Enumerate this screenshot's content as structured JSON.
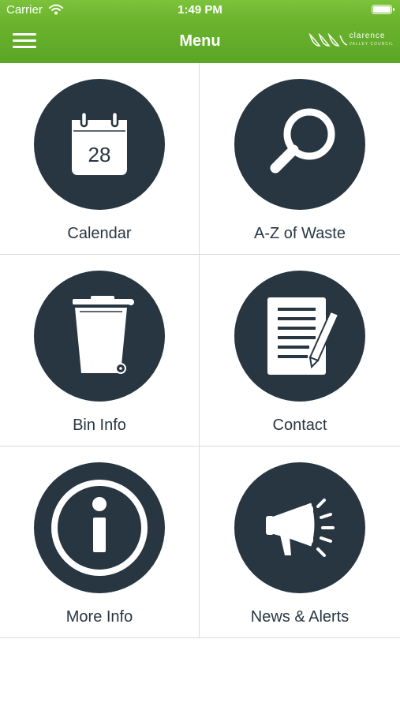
{
  "status_bar": {
    "carrier": "Carrier",
    "time": "1:49 PM"
  },
  "nav": {
    "title": "Menu",
    "logo_text": "clarence",
    "logo_subtext": "VALLEY COUNCIL"
  },
  "tiles": [
    {
      "label": "Calendar",
      "icon": "calendar-icon",
      "icon_text": "28"
    },
    {
      "label": "A-Z of Waste",
      "icon": "magnifier-icon"
    },
    {
      "label": "Bin Info",
      "icon": "wheelie-bin-icon"
    },
    {
      "label": "Contact",
      "icon": "document-pen-icon"
    },
    {
      "label": "More Info",
      "icon": "info-icon"
    },
    {
      "label": "News & Alerts",
      "icon": "megaphone-icon"
    }
  ],
  "colors": {
    "header_green": "#6db42f",
    "icon_circle": "#283642",
    "divider": "#dcdcdc"
  }
}
